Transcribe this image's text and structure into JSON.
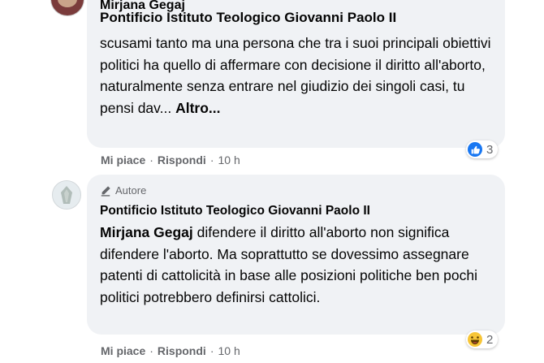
{
  "comment1": {
    "author": "Mirjana Gegaj",
    "mention": "Pontificio Istituto Teologico Giovanni Paolo II",
    "text": "scusami tanto ma una persona che tra i suoi principali obiettivi politici ha quello di affermare con decisione il diritto all'aborto, naturalmente senza entrare nel giudizio dei singoli casi, tu pensi dav...",
    "more_label": "Altro...",
    "actions": {
      "like": "Mi piace",
      "reply": "Rispondi",
      "separator": "·",
      "time": "10 h"
    },
    "reactions": {
      "icon": "like-icon",
      "count": "3"
    }
  },
  "comment2": {
    "badge": "Autore",
    "author": "Pontificio Istituto Teologico Giovanni Paolo II",
    "mention": "Mirjana Gegaj",
    "text": "difendere il diritto all'aborto non significa difendere l'aborto. Ma soprattutto se dovessimo assegnare patenti di cattolicità in base alle posizioni politiche ben pochi politici potrebbero definirsi cattolici.",
    "actions": {
      "like": "Mi piace",
      "reply": "Rispondi",
      "separator": "·",
      "time": "10 h"
    },
    "reactions": {
      "icon": "haha-icon",
      "count": "2"
    }
  },
  "colors": {
    "bubble": "#f0f2f5",
    "meta": "#65676b",
    "like": "#1877f2",
    "haha": "#f7c536"
  }
}
